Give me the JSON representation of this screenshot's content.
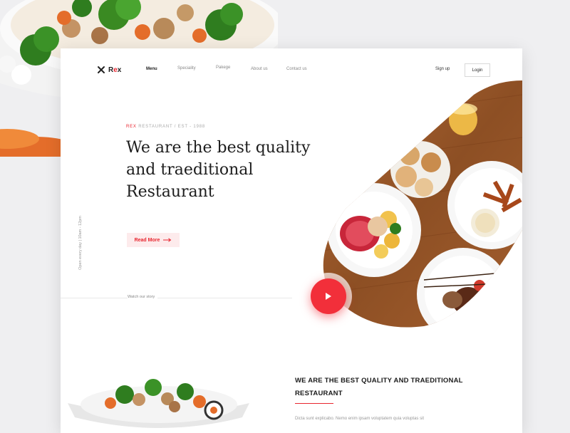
{
  "brand": {
    "x_mark": "X",
    "name_prefix": "R",
    "name_accent": "e",
    "name_suffix": "x"
  },
  "nav": {
    "items": [
      {
        "label": "Menu",
        "active": true
      },
      {
        "label": "Speciality",
        "active": false
      },
      {
        "label": "Pakege",
        "active": false
      },
      {
        "label": "About us",
        "active": false
      },
      {
        "label": "Contact us",
        "active": false
      }
    ],
    "signup_label": "Sign up",
    "login_label": "Login"
  },
  "hero": {
    "eyebrow_accent": "REX",
    "eyebrow_rest": " RESTAURANT / EST - 1988",
    "headline_lines": [
      "We are the best quality",
      "and traeditional",
      "Restaurant"
    ],
    "read_more_label": "Read More",
    "read_more_icon": "arrow-right-icon",
    "side_text": "Open every day | 10am - 12pm",
    "watch_story_label": "Watch our story",
    "play_icon": "play-icon"
  },
  "section": {
    "title_lines": [
      "WE ARE THE BEST QUALITY AND TRAEDITIONAL",
      "RESTAURANT"
    ],
    "body": "Dicta sunt explicabo. Nemo enim ipsam voluptatem quia voluptas sit"
  },
  "colors": {
    "accent": "#e8262f",
    "play_button": "#f22f3a",
    "wood_table": "#9b5a2c",
    "background": "#efeff1"
  }
}
